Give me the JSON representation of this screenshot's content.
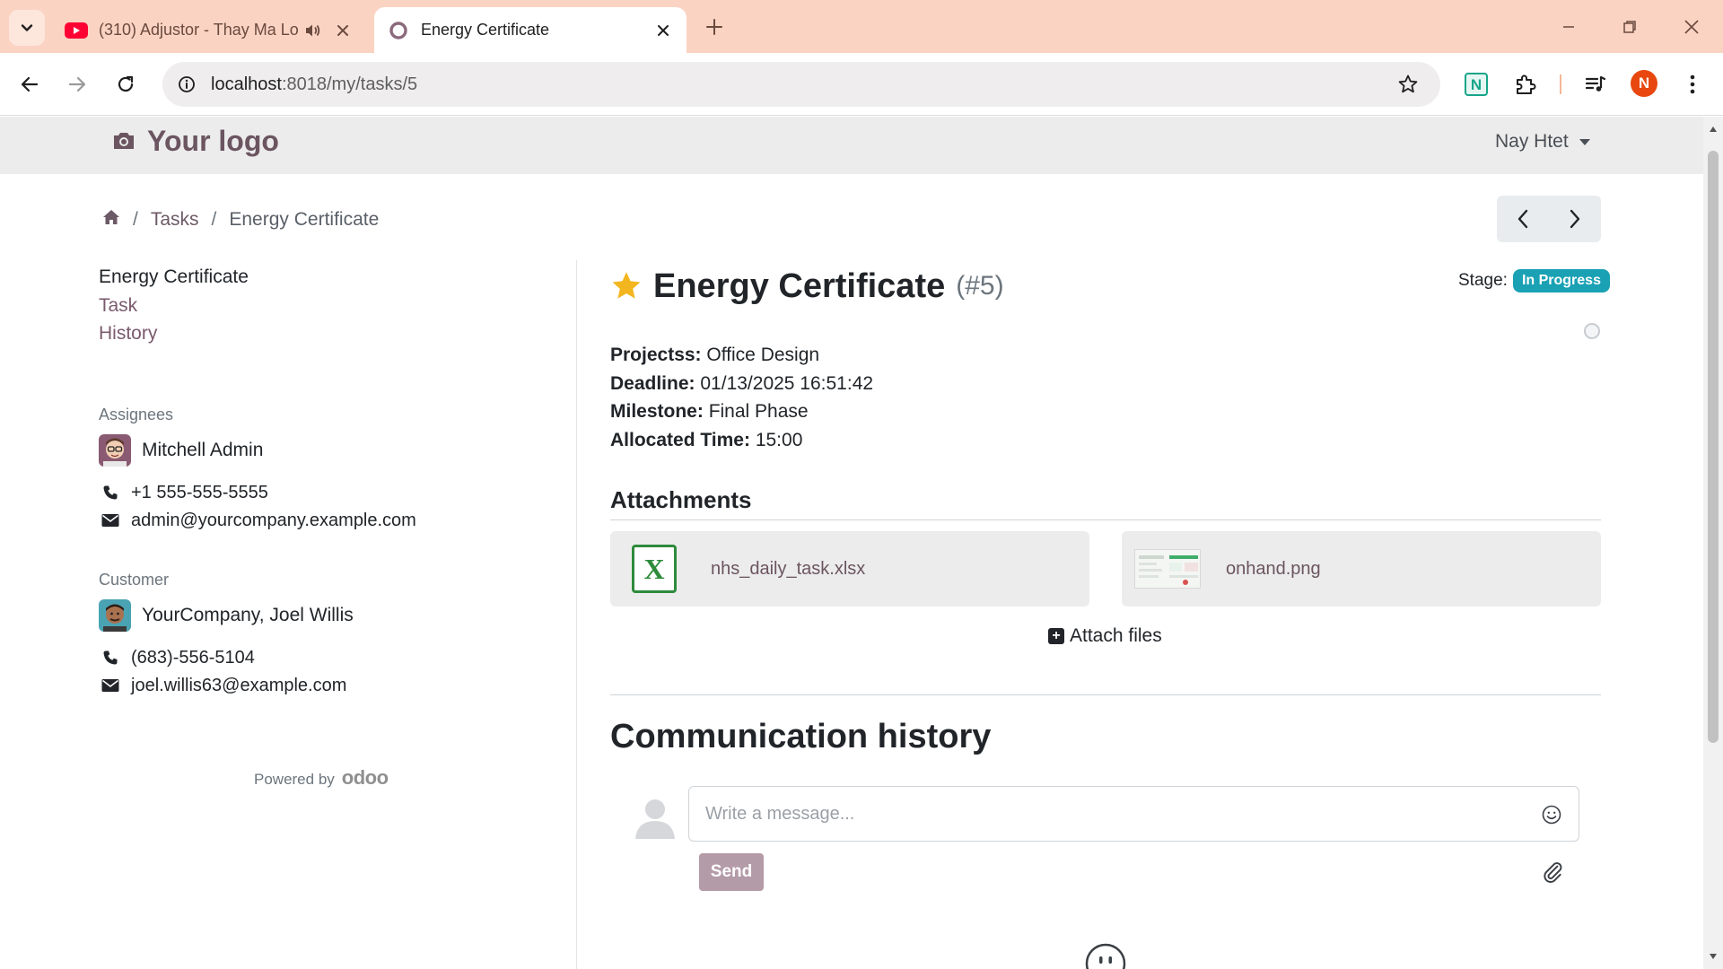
{
  "browser": {
    "tabs": [
      {
        "title": "(310) Adjustor - Thay Ma Lo",
        "active": false,
        "icon": "youtube-icon"
      },
      {
        "title": "Energy Certificate",
        "active": true,
        "icon": "odoo-circle-icon"
      }
    ],
    "url_host": "localhost",
    "url_path": ":8018/my/tasks/5",
    "profile_initial": "N",
    "colors": {
      "tabbar": "#fbd3c3",
      "profile": "#e8470f"
    }
  },
  "header": {
    "logo_text": "Your logo",
    "user_name": "Nay Htet"
  },
  "breadcrumb": {
    "home_icon": "home-icon",
    "items": [
      "Tasks",
      "Energy Certificate"
    ]
  },
  "sidebar": {
    "nav": [
      "Energy Certificate",
      "Task",
      "History"
    ],
    "assignees_label": "Assignees",
    "assignee": {
      "name": "Mitchell Admin",
      "phone": "+1 555-555-5555",
      "email": "admin@yourcompany.example.com"
    },
    "customer_label": "Customer",
    "customer": {
      "name": "YourCompany, Joel Willis",
      "phone": "(683)-556-5104",
      "email": "joel.willis63@example.com"
    },
    "powered_by": "Powered by",
    "powered_brand": "odoo"
  },
  "task": {
    "title": "Energy Certificate",
    "ref": "(#5)",
    "stage_label": "Stage:",
    "stage": "In Progress",
    "fields": [
      {
        "label": "Projectss:",
        "value": "Office Design"
      },
      {
        "label": "Deadline:",
        "value": "01/13/2025 16:51:42"
      },
      {
        "label": "Milestone:",
        "value": "Final Phase"
      },
      {
        "label": "Allocated Time:",
        "value": "15:00"
      }
    ],
    "colors": {
      "stage_badge": "#1aa1b4",
      "star": "#f3b61f"
    }
  },
  "attachments": {
    "heading": "Attachments",
    "files": [
      {
        "name": "nhs_daily_task.xlsx",
        "type": "xlsx-icon"
      },
      {
        "name": "onhand.png",
        "type": "image-thumbnail"
      }
    ],
    "attach_label": "Attach files"
  },
  "communication": {
    "heading": "Communication history",
    "placeholder": "Write a message...",
    "send_label": "Send"
  }
}
